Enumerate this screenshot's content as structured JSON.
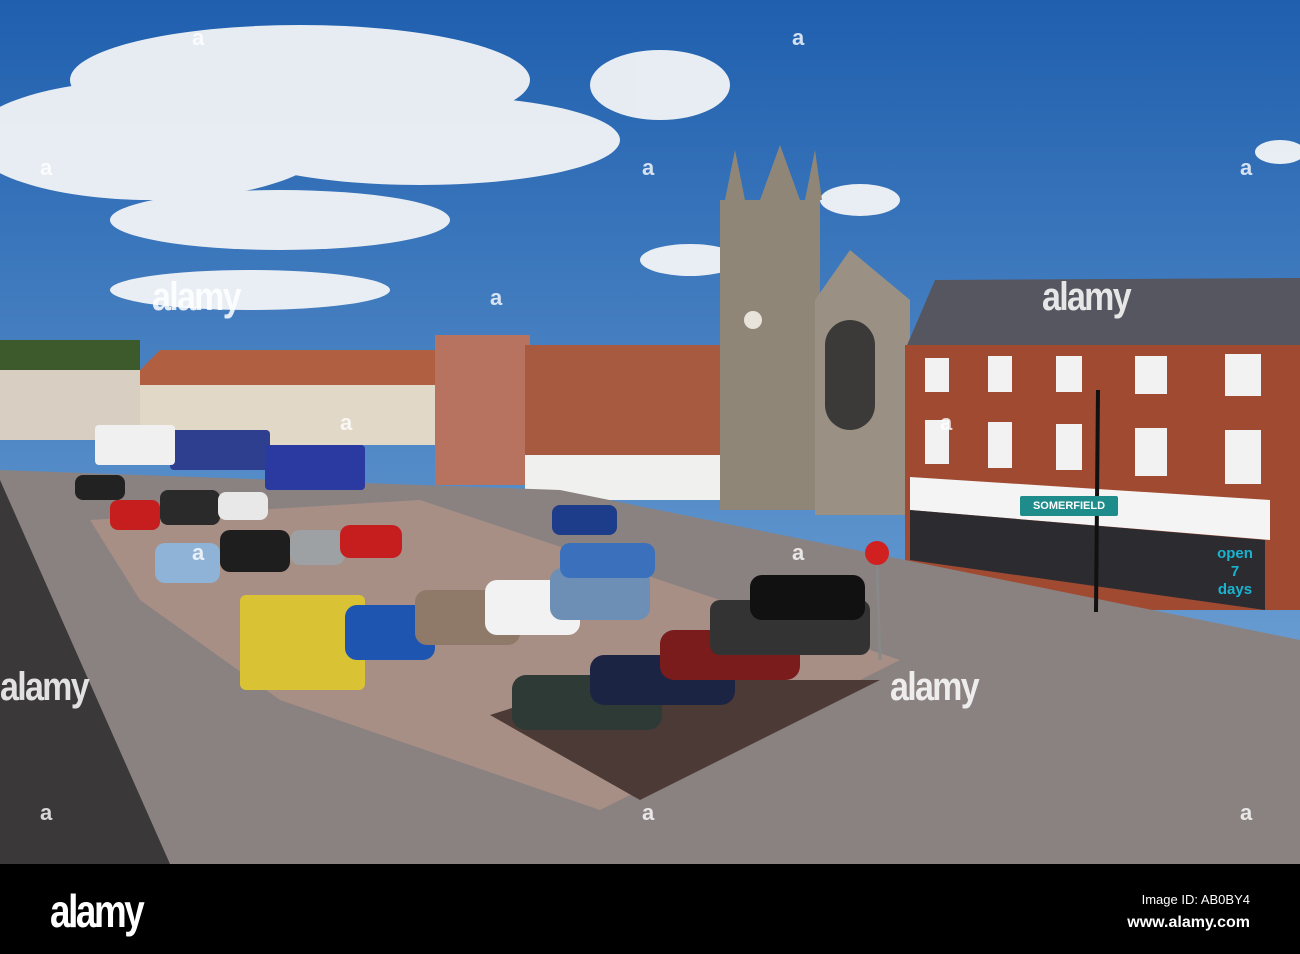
{
  "watermark": {
    "logo": "alamy",
    "mark": "a"
  },
  "shop": {
    "sign": "SOMERFIELD",
    "window_line1": "open",
    "window_line2": "7",
    "window_line3": "days"
  },
  "footer": {
    "logo": "alamy",
    "image_id": "Image ID: AB0BY4",
    "url": "www.alamy.com"
  }
}
